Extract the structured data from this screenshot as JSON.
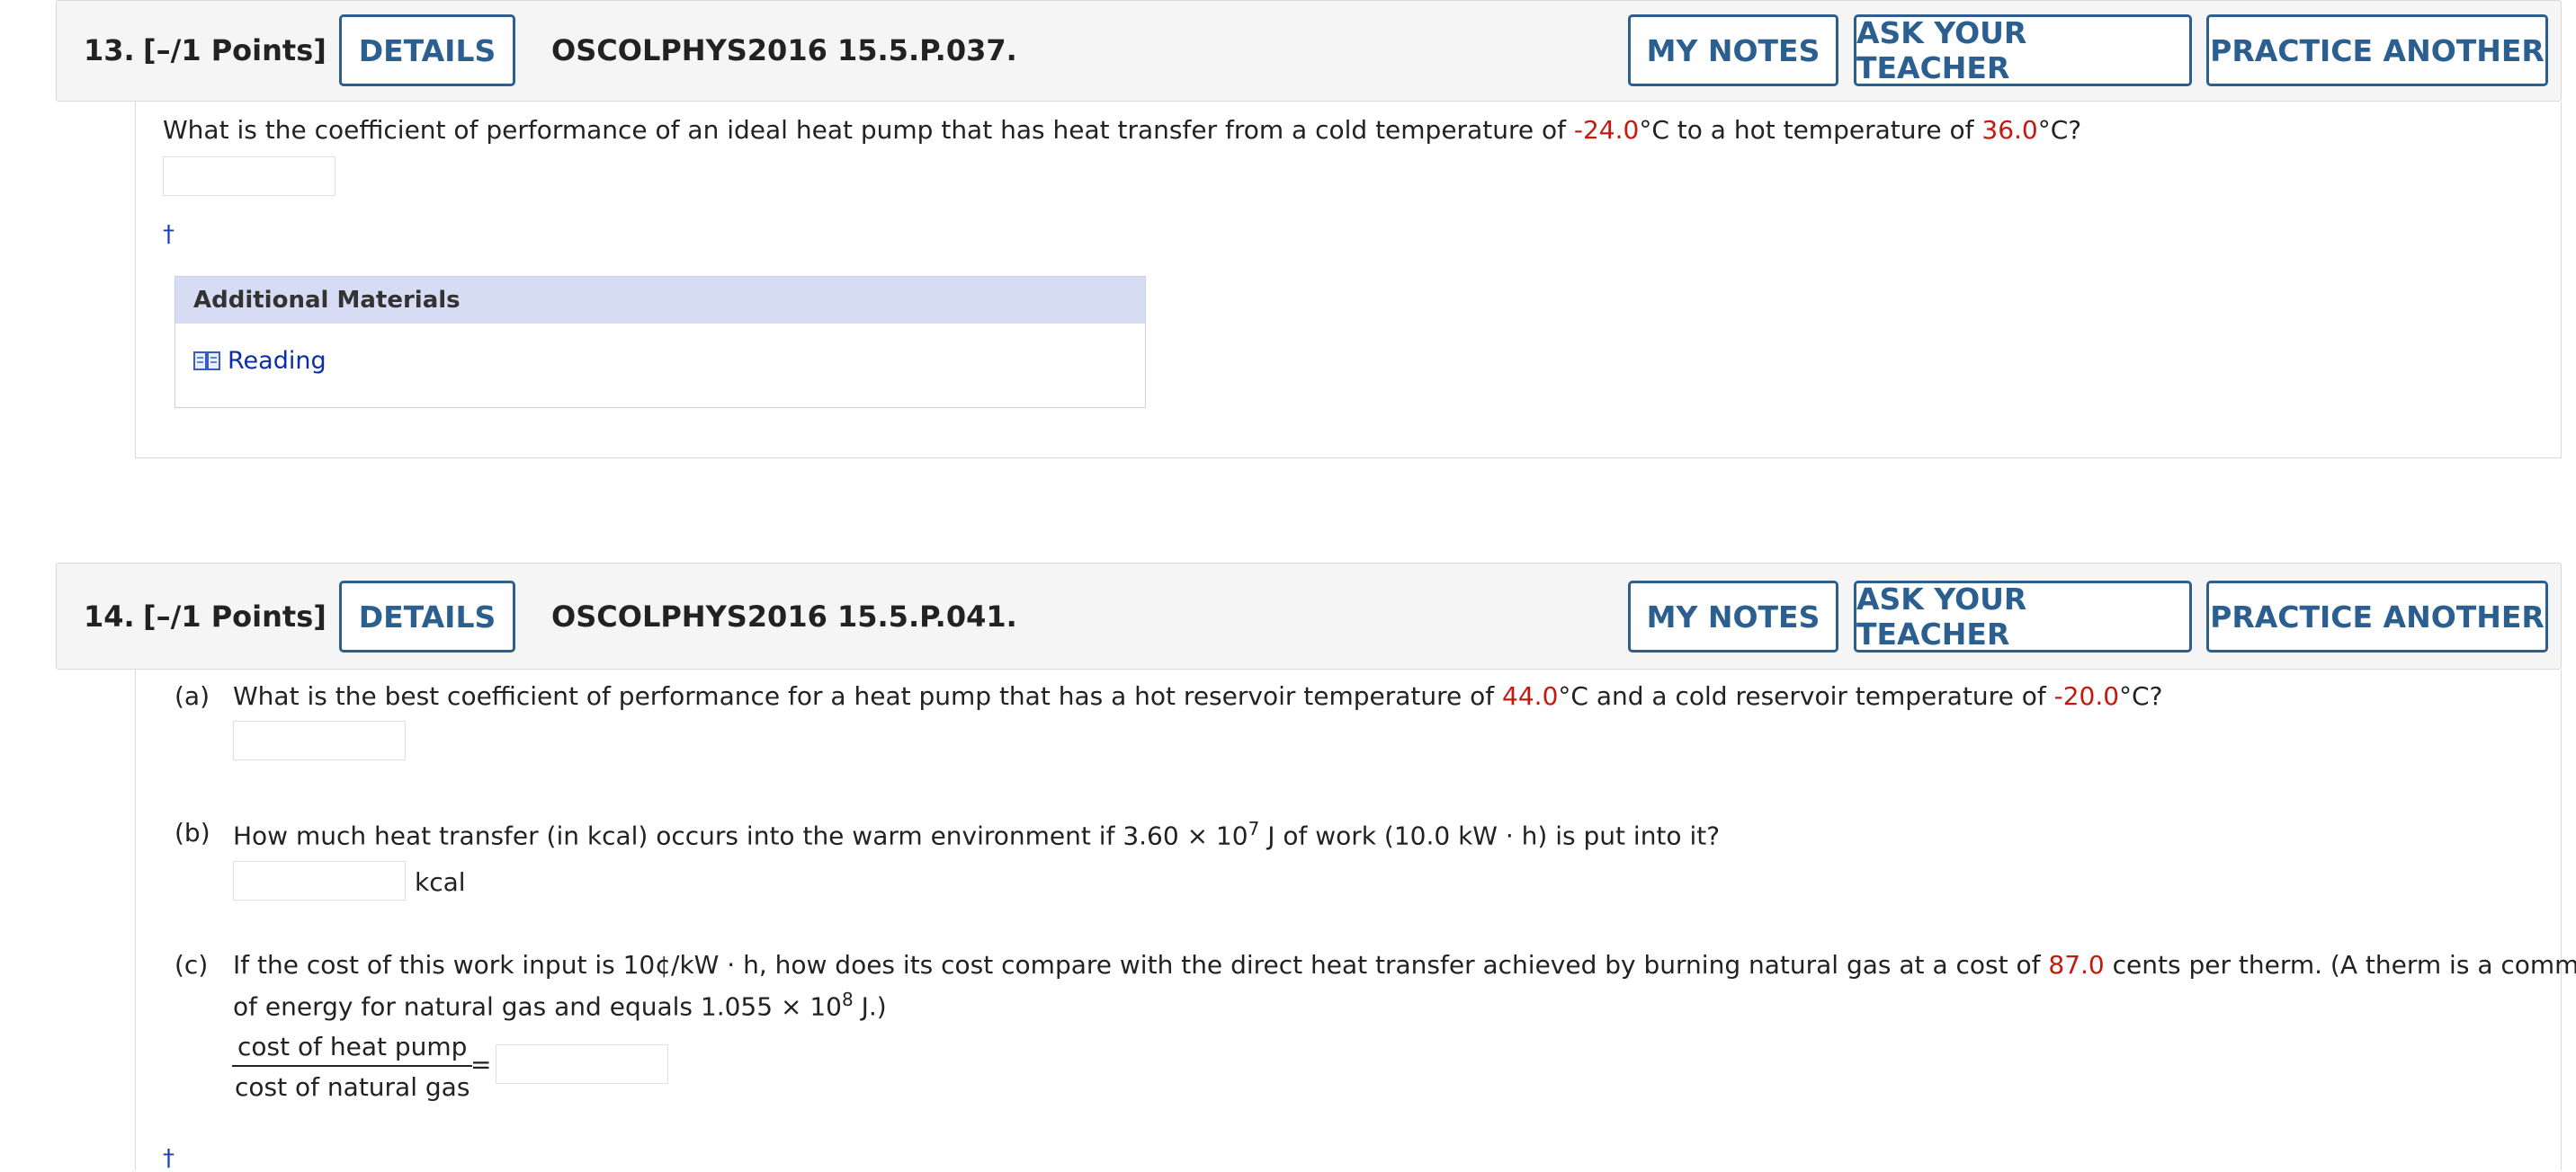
{
  "q13": {
    "number": "13.",
    "points": "[–/1 Points]",
    "details": "DETAILS",
    "code": "OSCOLPHYS2016 15.5.P.037.",
    "my_notes": "MY NOTES",
    "ask_teacher": "ASK YOUR TEACHER",
    "practice": "PRACTICE ANOTHER",
    "text_a": "What is the coefficient of performance of an ideal heat pump that has heat transfer from a cold temperature of ",
    "cold_temp": "-24.0",
    "text_b": "°C to a hot temperature of ",
    "hot_temp": "36.0",
    "text_c": "°C?",
    "dagger": "†",
    "additional_materials": "Additional Materials",
    "reading": "Reading"
  },
  "q14": {
    "number": "14.",
    "points": "[–/1 Points]",
    "details": "DETAILS",
    "code": "OSCOLPHYS2016 15.5.P.041.",
    "my_notes": "MY NOTES",
    "ask_teacher": "ASK YOUR TEACHER",
    "practice": "PRACTICE ANOTHER",
    "a_label": "(a)",
    "a_text_1": "What is the best coefficient of performance for a heat pump that has a hot reservoir temperature of ",
    "a_hot": "44.0",
    "a_text_2": "°C and a cold reservoir temperature of ",
    "a_cold": "-20.0",
    "a_text_3": "°C?",
    "b_label": "(b)",
    "b_text_1": "How much heat transfer (in kcal) occurs into the warm environment if 3.60 × 10",
    "b_exp": "7",
    "b_text_2": " J of work (10.0 kW · h) is put into it?",
    "b_unit": "kcal",
    "c_label": "(c)",
    "c_text_1": "If the cost of this work input is 10¢/kW · h, how does its cost compare with the direct heat transfer achieved by burning natural gas at a cost of ",
    "c_cost": "87.0",
    "c_text_2": " cents per therm. (A therm is a common unit",
    "c_text_3": "of energy for natural gas and equals 1.055 × 10",
    "c_exp": "8",
    "c_text_4": " J.)",
    "frac_num": "cost of heat pump",
    "frac_den": "cost of natural gas",
    "equals": "=",
    "dagger": "†"
  },
  "colors": {
    "accent_button": "#2b5f8f",
    "value_red": "#c41a0e",
    "link_blue": "#0b2ea8",
    "materials_header_bg": "#d6dcf3"
  },
  "icons": {
    "reading": "book-icon"
  }
}
